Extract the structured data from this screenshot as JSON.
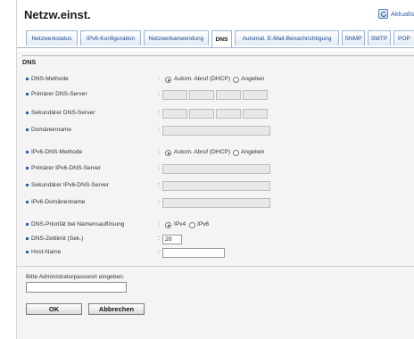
{
  "header": {
    "title": "Netzw.einst.",
    "refresh_label": "Aktualis"
  },
  "tabs": [
    {
      "label": "Netzwerkstatus"
    },
    {
      "label": "IPv6-Konfiguration"
    },
    {
      "label": "Netzwerkanwendung"
    },
    {
      "label": "DNS",
      "active": true
    },
    {
      "label": "Automat. E-Mail-Benachrichtigung"
    },
    {
      "label": "SNMP"
    },
    {
      "label": "SMTP"
    },
    {
      "label": "POP"
    }
  ],
  "section": {
    "title": "DNS"
  },
  "fields": {
    "dns_method": {
      "label": "DNS-Methode",
      "opt_auto": "Autom. Abruf (DHCP)",
      "opt_manual": "Angeben"
    },
    "primary_dns": {
      "label": "Primärer DNS-Server"
    },
    "secondary_dns": {
      "label": "Sekundärer DNS-Server"
    },
    "domain": {
      "label": "Domänenname"
    },
    "ipv6_dns_method": {
      "label": "IPv6-DNS-Methode",
      "opt_auto": "Autom. Abruf (DHCP)",
      "opt_manual": "Angeben"
    },
    "primary_ipv6_dns": {
      "label": "Primärer IPv6-DNS-Server"
    },
    "secondary_ipv6_dns": {
      "label": "Sekundärer IPv6-DNS-Server"
    },
    "ipv6_domain": {
      "label": "IPv6-Domänenname"
    },
    "dns_priority": {
      "label": "DNS-Priorität bei Namensauflösung",
      "opt_ipv4": "IPv4",
      "opt_ipv6": "IPv6"
    },
    "dns_timeout": {
      "label": "DNS-Zeitlimit (Sek.)",
      "value": "20"
    },
    "host_name": {
      "label": "Host-Name",
      "value": ""
    }
  },
  "password": {
    "label": "Bitte Administratorpasswort eingeben.",
    "value": ""
  },
  "buttons": {
    "ok": "OK",
    "cancel": "Abbrechen"
  }
}
